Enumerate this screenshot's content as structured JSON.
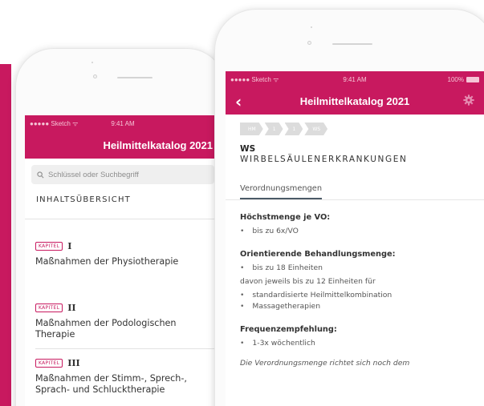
{
  "accent_color": "#c8195f",
  "back_phone": {
    "status": {
      "carrier": "●●●●● Sketch ᯤ",
      "time": "9:41 AM"
    },
    "title": "Heilmittelkatalog 2021",
    "search": {
      "placeholder": "Schlüssel oder Suchbegriff"
    },
    "toc_heading": "INHALTSÜBERSICHT",
    "chapters": [
      {
        "badge": "KAPITEL",
        "roman": "I",
        "title": "Maßnahmen der Physiotherapie"
      },
      {
        "badge": "KAPITEL",
        "roman": "II",
        "title": "Maßnahmen der Podologischen Therapie"
      },
      {
        "badge": "KAPITEL",
        "roman": "III",
        "title": "Maßnahmen der Stimm-, Sprech-, Sprach- und Schlucktherapie"
      }
    ]
  },
  "front_phone": {
    "status": {
      "carrier": "●●●●● Sketch ᯤ",
      "time": "9:41 AM",
      "battery": "100%"
    },
    "title": "Heilmittelkatalog 2021",
    "breadcrumbs": [
      "HM",
      "1",
      "1",
      "WS"
    ],
    "code": "WS",
    "chapter_name": "WIRBELSÄULENERKRANKUNGEN",
    "tab": "Verordnungsmengen",
    "content": {
      "max_heading": "Höchstmenge je VO:",
      "max_items": [
        "bis zu 6x/VO"
      ],
      "orient_heading": "Orientierende Behandlungsmenge:",
      "orient_items": [
        "bis zu 18 Einheiten"
      ],
      "orient_note": "davon jeweils bis zu 12 Einheiten für",
      "orient_sub_items": [
        "standardisierte Heilmittelkombination",
        "Massagetherapien"
      ],
      "freq_heading": "Frequenzempfehlung:",
      "freq_items": [
        "1-3x wöchentlich"
      ],
      "footnote": "Die Verordnungsmenge richtet sich noch dem"
    }
  }
}
